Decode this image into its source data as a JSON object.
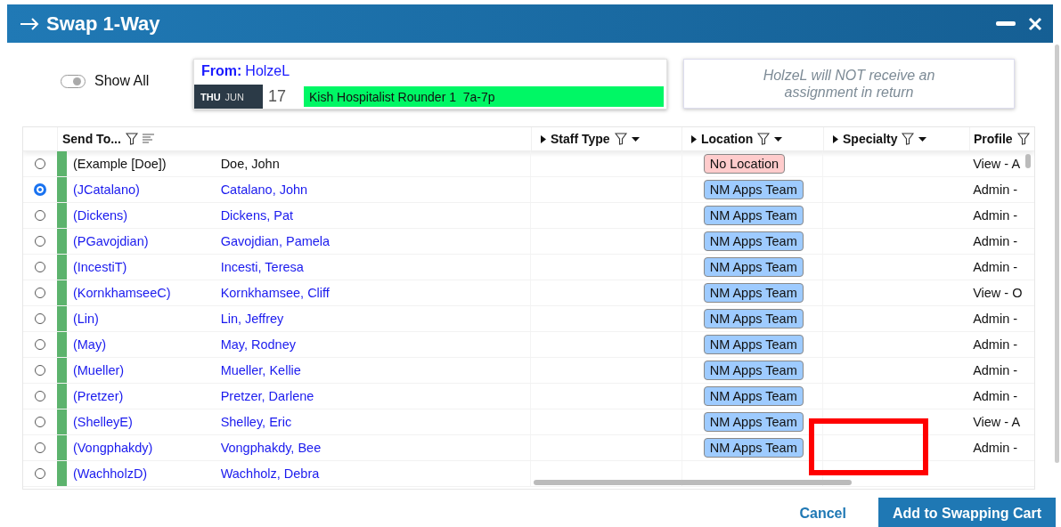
{
  "window": {
    "title": "Swap 1-Way"
  },
  "show_all": {
    "label": "Show All",
    "on": true
  },
  "from": {
    "label": "From:",
    "user": "HolzeL",
    "day": "THU",
    "month": "JUN",
    "date": "17",
    "shift": "Kish Hospitalist Rounder 1  7a-7p"
  },
  "note": "HolzeL will NOT receive an assignment in return",
  "table": {
    "columns": [
      {
        "label": "Send To...",
        "kind": "sort"
      },
      {
        "label": "Staff Type",
        "kind": "group"
      },
      {
        "label": "Location",
        "kind": "group"
      },
      {
        "label": "Specialty",
        "kind": "group"
      },
      {
        "label": "Profile",
        "kind": "plain"
      }
    ],
    "rows": [
      {
        "username": "(Example [Doe])",
        "name": "Doe, John",
        "link": false,
        "location": "No Location",
        "color": "#ffcccc",
        "profile": "View - A",
        "selected": false
      },
      {
        "username": "(JCatalano)",
        "name": "Catalano, John",
        "link": true,
        "location": "NM Apps Team",
        "color": "#9ecbff",
        "profile": "Admin -",
        "selected": true
      },
      {
        "username": "(Dickens)",
        "name": "Dickens, Pat",
        "link": true,
        "location": "NM Apps Team",
        "color": "#9ecbff",
        "profile": "Admin -",
        "selected": false
      },
      {
        "username": "(PGavojdian)",
        "name": "Gavojdian, Pamela",
        "link": true,
        "location": "NM Apps Team",
        "color": "#9ecbff",
        "profile": "Admin -",
        "selected": false
      },
      {
        "username": "(IncestiT)",
        "name": "Incesti, Teresa",
        "link": true,
        "location": "NM Apps Team",
        "color": "#9ecbff",
        "profile": "Admin -",
        "selected": false
      },
      {
        "username": "(KornkhamseeC)",
        "name": "Kornkhamsee, Cliff",
        "link": true,
        "location": "NM Apps Team",
        "color": "#9ecbff",
        "profile": "View - O",
        "selected": false
      },
      {
        "username": "(Lin)",
        "name": "Lin, Jeffrey",
        "link": true,
        "location": "NM Apps Team",
        "color": "#9ecbff",
        "profile": "Admin -",
        "selected": false
      },
      {
        "username": "(May)",
        "name": "May, Rodney",
        "link": true,
        "location": "NM Apps Team",
        "color": "#9ecbff",
        "profile": "Admin -",
        "selected": false
      },
      {
        "username": "(Mueller)",
        "name": "Mueller, Kellie",
        "link": true,
        "location": "NM Apps Team",
        "color": "#9ecbff",
        "profile": "Admin -",
        "selected": false
      },
      {
        "username": "(Pretzer)",
        "name": "Pretzer, Darlene",
        "link": true,
        "location": "NM Apps Team",
        "color": "#9ecbff",
        "profile": "Admin -",
        "selected": false
      },
      {
        "username": "(ShelleyE)",
        "name": "Shelley, Eric",
        "link": true,
        "location": "NM Apps Team",
        "color": "#9ecbff",
        "profile": "View - A",
        "selected": false
      },
      {
        "username": "(Vongphakdy)",
        "name": "Vongphakdy, Bee",
        "link": true,
        "location": "NM Apps Team",
        "color": "#9ecbff",
        "profile": "Admin -",
        "selected": false
      },
      {
        "username": "(WachholzD)",
        "name": "Wachholz, Debra",
        "link": true,
        "selected": false
      }
    ]
  },
  "buttons": {
    "cancel": "Cancel",
    "confirm": "Add to Swapping Cart"
  }
}
